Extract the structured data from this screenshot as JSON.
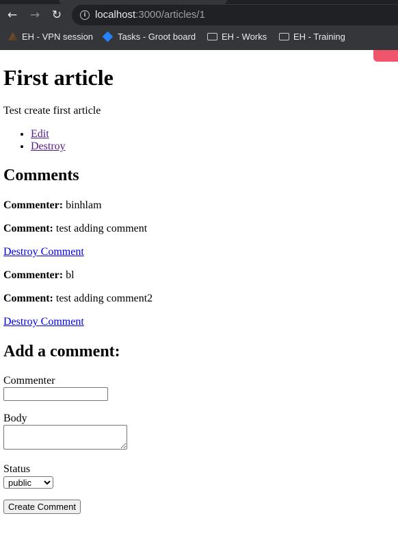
{
  "browser": {
    "url_host": "localhost",
    "url_rest": ":3000/articles/1",
    "bookmarks": [
      {
        "label": "EH - VPN session",
        "icon": "vpn-icon"
      },
      {
        "label": "Tasks - Groot board",
        "icon": "jira-icon"
      },
      {
        "label": "EH - Works",
        "icon": "folder-icon"
      },
      {
        "label": "EH - Training",
        "icon": "folder-icon"
      }
    ]
  },
  "article": {
    "title": "First article",
    "body": "Test create first article",
    "links": [
      "Edit",
      "Destroy"
    ]
  },
  "comments": {
    "heading": "Comments",
    "commenter_label": "Commenter:",
    "comment_label": "Comment:",
    "destroy_label": "Destroy Comment",
    "items": [
      {
        "commenter": "binhlam",
        "body": "test adding comment"
      },
      {
        "commenter": "bl",
        "body": "test adding comment2"
      }
    ]
  },
  "form": {
    "heading": "Add a comment:",
    "commenter_label": "Commenter",
    "commenter_value": "",
    "body_label": "Body",
    "body_value": "",
    "status_label": "Status",
    "status_selected": "public",
    "submit_label": "Create Comment"
  }
}
